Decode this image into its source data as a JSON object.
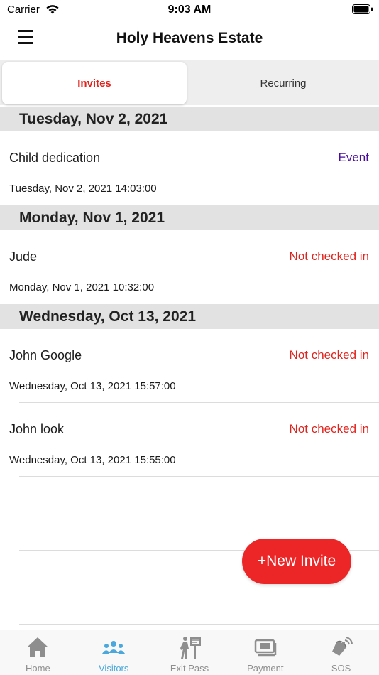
{
  "status_bar": {
    "carrier": "Carrier",
    "time": "9:03 AM"
  },
  "header": {
    "title": "Holy Heavens Estate"
  },
  "tabs": [
    {
      "label": "Invites",
      "active": true
    },
    {
      "label": "Recurring",
      "active": false
    }
  ],
  "sections": [
    {
      "date": "Tuesday, Nov 2, 2021",
      "rows": [
        {
          "name": "Child dedication",
          "status": "Event",
          "status_type": "event",
          "datetime": "Tuesday, Nov 2, 2021  14:03:00"
        }
      ]
    },
    {
      "date": "Monday, Nov 1, 2021",
      "rows": [
        {
          "name": "Jude",
          "status": "Not checked in",
          "status_type": "unchecked",
          "datetime": "Monday, Nov 1, 2021  10:32:00"
        }
      ]
    },
    {
      "date": "Wednesday, Oct 13, 2021",
      "rows": [
        {
          "name": "John Google",
          "status": "Not checked in",
          "status_type": "unchecked",
          "datetime": "Wednesday, Oct 13, 2021  15:57:00"
        },
        {
          "name": "John look",
          "status": "Not checked in",
          "status_type": "unchecked",
          "datetime": "Wednesday, Oct 13, 2021  15:55:00"
        }
      ]
    }
  ],
  "fab": {
    "label": "+New Invite"
  },
  "tab_bar": [
    {
      "label": "Home",
      "icon": "home-icon",
      "active": false
    },
    {
      "label": "Visitors",
      "icon": "visitors-icon",
      "active": true
    },
    {
      "label": "Exit Pass",
      "icon": "exit-pass-icon",
      "active": false
    },
    {
      "label": "Payment",
      "icon": "payment-icon",
      "active": false
    },
    {
      "label": "SOS",
      "icon": "sos-icon",
      "active": false
    }
  ],
  "colors": {
    "accent_red": "#e0241e",
    "event_purple": "#4a0e9a",
    "active_tab_blue": "#4aa8dc"
  }
}
